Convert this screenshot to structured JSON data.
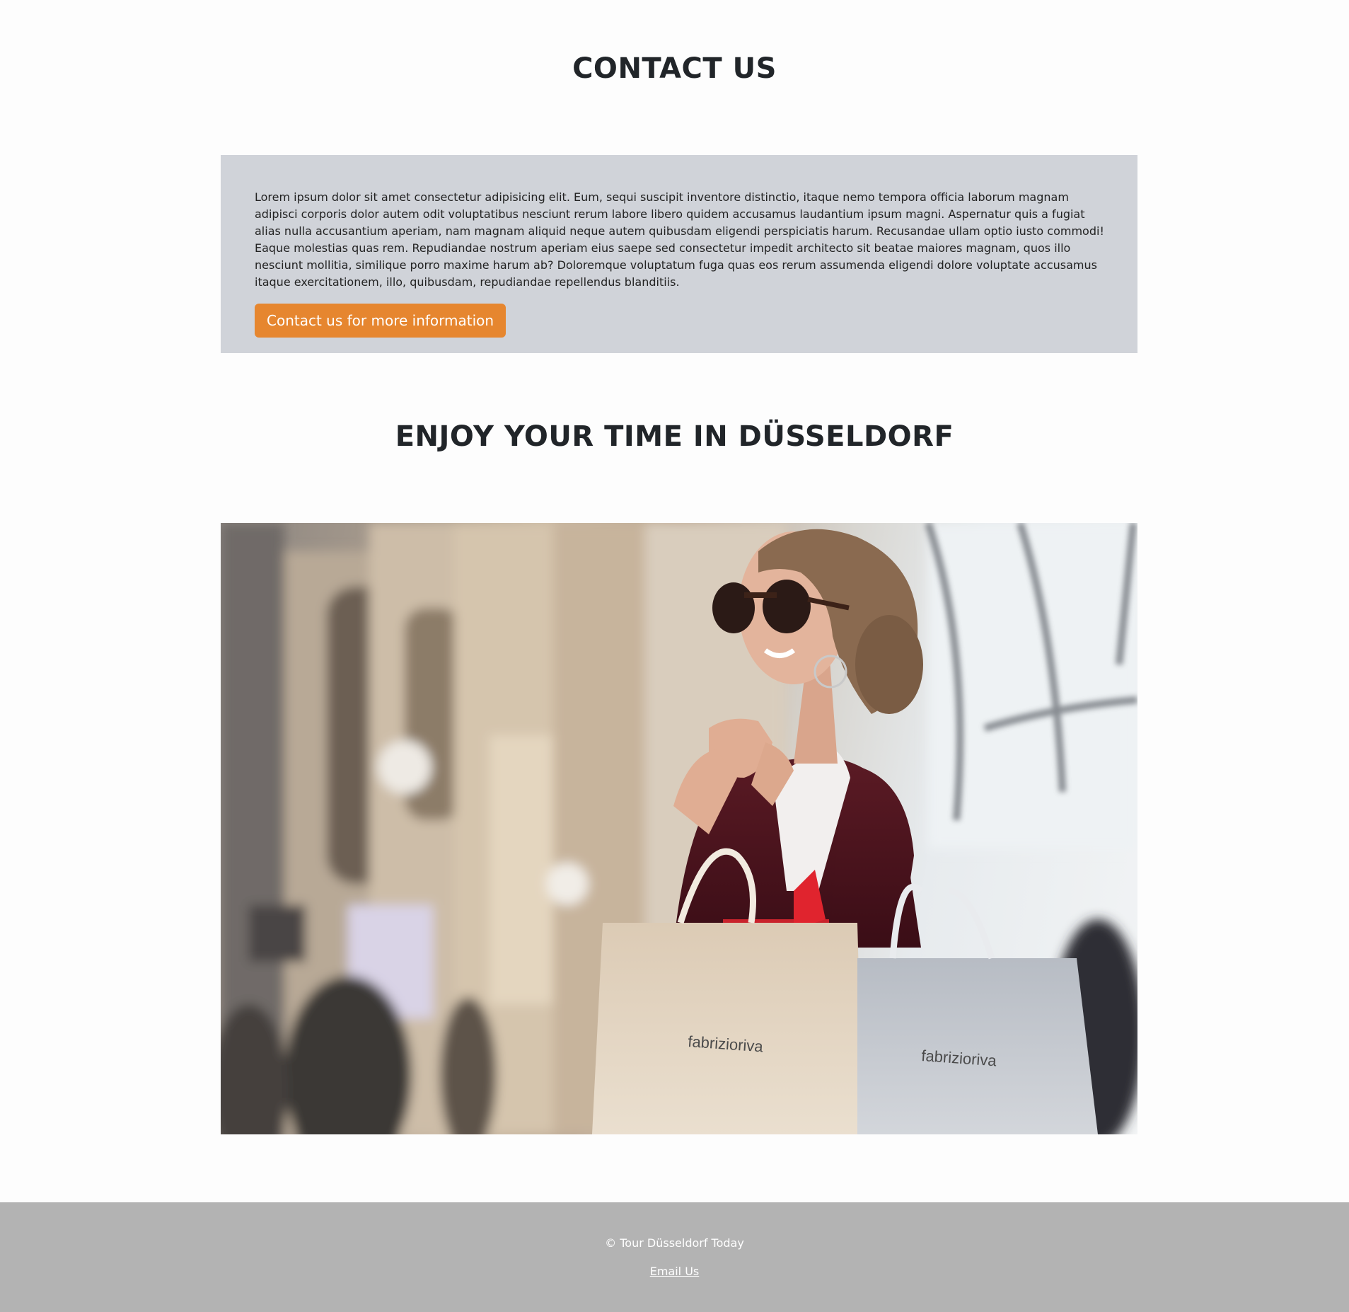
{
  "contact": {
    "title": "CONTACT US",
    "body": "Lorem ipsum dolor sit amet consectetur adipisicing elit. Eum, sequi suscipit inventore distinctio, itaque nemo tempora officia laborum magnam adipisci corporis dolor autem odit voluptatibus nesciunt rerum labore libero quidem accusamus laudantium ipsum magni. Aspernatur quis a fugiat alias nulla accusantium aperiam, nam magnam aliquid neque autem quibusdam eligendi perspiciatis harum. Recusandae ullam optio iusto commodi! Eaque molestias quas rem. Repudiandae nostrum aperiam eius saepe sed consectetur impedit architecto sit beatae maiores magnam, quos illo nesciunt mollitia, similique porro maxime harum ab? Doloremque voluptatum fuga quas eos rerum assumenda eligendi dolore voluptate accusamus itaque exercitationem, illo, quibusdam, repudiandae repellendus blanditiis.",
    "button_label": "Contact us for more information",
    "button_color": "#e6862f",
    "box_color": "#d0d3d9"
  },
  "enjoy": {
    "title": "ENJOY YOUR TIME IN DÜSSELDORF",
    "bag_brand": "fabrizioriva"
  },
  "footer": {
    "copyright": "© Tour Düsseldorf Today",
    "email_link": "Email Us",
    "background": "#b3b3b3"
  }
}
